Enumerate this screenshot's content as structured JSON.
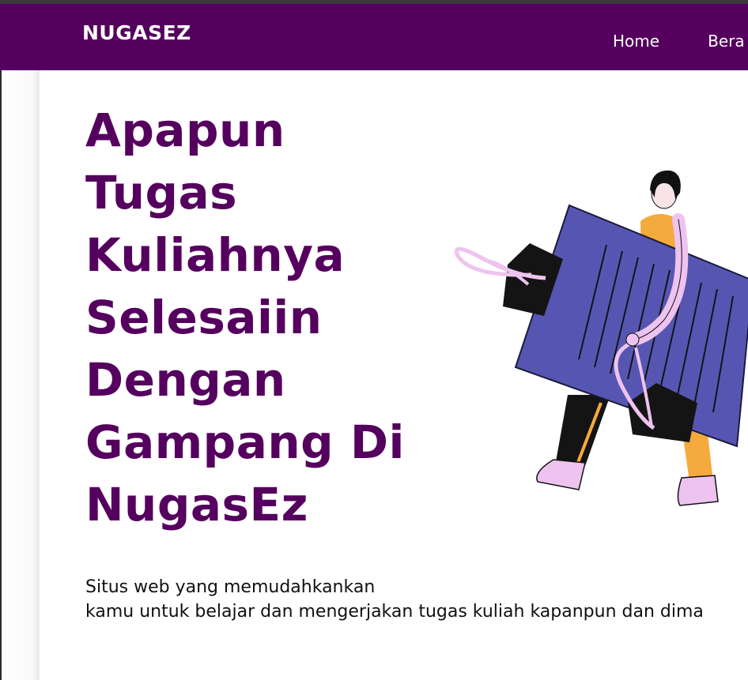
{
  "navbar": {
    "brand": "NUGASEZ",
    "links": [
      "Home",
      "Bera"
    ],
    "background": "#55005e"
  },
  "hero": {
    "title_lines": [
      "Apapun",
      "Tugas",
      "Kuliahnya",
      "Selesaiin",
      "Dengan",
      "Gampang Di",
      "NugasEz"
    ],
    "description_lines": [
      "Situs web yang memudahkankan",
      "kamu untuk belajar dan mengerjakan tugas kuliah kapanpun dan dima"
    ],
    "title_color": "#55005e",
    "illustration": "person-carrying-folders-illustration"
  }
}
